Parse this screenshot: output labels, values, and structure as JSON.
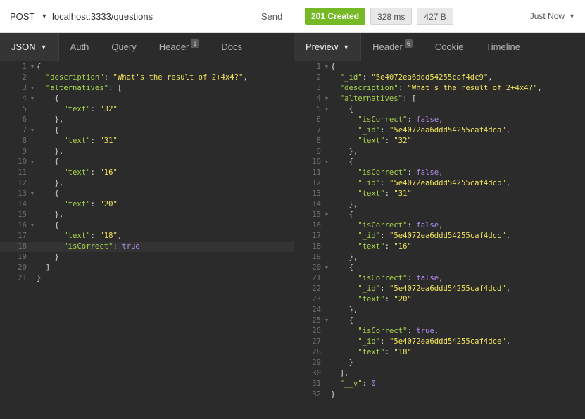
{
  "request": {
    "method": "POST",
    "url": "localhost:3333/questions",
    "send_label": "Send"
  },
  "response": {
    "status": "201 Created",
    "time": "328 ms",
    "size": "427 B",
    "when": "Just Now"
  },
  "request_tabs": [
    {
      "label": "JSON",
      "active": true
    },
    {
      "label": "Auth"
    },
    {
      "label": "Query"
    },
    {
      "label": "Header",
      "count": "1"
    },
    {
      "label": "Docs"
    }
  ],
  "response_tabs": [
    {
      "label": "Preview",
      "active": true
    },
    {
      "label": "Header",
      "count": "6"
    },
    {
      "label": "Cookie"
    },
    {
      "label": "Timeline"
    }
  ],
  "request_body": [
    {
      "n": "1",
      "fold": true,
      "t": [
        [
          "p",
          "{"
        ]
      ]
    },
    {
      "n": "2",
      "t": [
        [
          "p",
          "  "
        ],
        [
          "k",
          "\"description\""
        ],
        [
          "p",
          ": "
        ],
        [
          "s",
          "\"What's the result of 2+4x4?\""
        ],
        [
          "p",
          ","
        ]
      ]
    },
    {
      "n": "3",
      "fold": true,
      "t": [
        [
          "p",
          "  "
        ],
        [
          "k",
          "\"alternatives\""
        ],
        [
          "p",
          ": ["
        ]
      ]
    },
    {
      "n": "4",
      "fold": true,
      "t": [
        [
          "p",
          "    {"
        ]
      ]
    },
    {
      "n": "5",
      "t": [
        [
          "p",
          "      "
        ],
        [
          "k",
          "\"text\""
        ],
        [
          "p",
          ": "
        ],
        [
          "s",
          "\"32\""
        ]
      ]
    },
    {
      "n": "6",
      "t": [
        [
          "p",
          "    },"
        ]
      ]
    },
    {
      "n": "7",
      "fold": true,
      "t": [
        [
          "p",
          "    {"
        ]
      ]
    },
    {
      "n": "8",
      "t": [
        [
          "p",
          "      "
        ],
        [
          "k",
          "\"text\""
        ],
        [
          "p",
          ": "
        ],
        [
          "s",
          "\"31\""
        ]
      ]
    },
    {
      "n": "9",
      "t": [
        [
          "p",
          "    },"
        ]
      ]
    },
    {
      "n": "10",
      "fold": true,
      "t": [
        [
          "p",
          "    {"
        ]
      ]
    },
    {
      "n": "11",
      "t": [
        [
          "p",
          "      "
        ],
        [
          "k",
          "\"text\""
        ],
        [
          "p",
          ": "
        ],
        [
          "s",
          "\"16\""
        ]
      ]
    },
    {
      "n": "12",
      "t": [
        [
          "p",
          "    },"
        ]
      ]
    },
    {
      "n": "13",
      "fold": true,
      "t": [
        [
          "p",
          "    {"
        ]
      ]
    },
    {
      "n": "14",
      "t": [
        [
          "p",
          "      "
        ],
        [
          "k",
          "\"text\""
        ],
        [
          "p",
          ": "
        ],
        [
          "s",
          "\"20\""
        ]
      ]
    },
    {
      "n": "15",
      "t": [
        [
          "p",
          "    },"
        ]
      ]
    },
    {
      "n": "16",
      "fold": true,
      "t": [
        [
          "p",
          "    {"
        ]
      ]
    },
    {
      "n": "17",
      "t": [
        [
          "p",
          "      "
        ],
        [
          "k",
          "\"text\""
        ],
        [
          "p",
          ": "
        ],
        [
          "s",
          "\"18\""
        ],
        [
          "p",
          ","
        ]
      ]
    },
    {
      "n": "18",
      "hl": true,
      "t": [
        [
          "p",
          "      "
        ],
        [
          "k",
          "\"isCorrect\""
        ],
        [
          "p",
          ": "
        ],
        [
          "b",
          "true"
        ]
      ]
    },
    {
      "n": "19",
      "t": [
        [
          "p",
          "    }"
        ]
      ]
    },
    {
      "n": "20",
      "t": [
        [
          "p",
          "  ]"
        ]
      ]
    },
    {
      "n": "21",
      "t": [
        [
          "p",
          "}"
        ]
      ]
    }
  ],
  "response_body": [
    {
      "n": "1",
      "fold": true,
      "t": [
        [
          "p",
          "{"
        ]
      ]
    },
    {
      "n": "2",
      "t": [
        [
          "p",
          "  "
        ],
        [
          "k",
          "\"_id\""
        ],
        [
          "p",
          ": "
        ],
        [
          "s",
          "\"5e4072ea6ddd54255caf4dc9\""
        ],
        [
          "p",
          ","
        ]
      ]
    },
    {
      "n": "3",
      "t": [
        [
          "p",
          "  "
        ],
        [
          "k",
          "\"description\""
        ],
        [
          "p",
          ": "
        ],
        [
          "s",
          "\"What's the result of 2+4x4?\""
        ],
        [
          "p",
          ","
        ]
      ]
    },
    {
      "n": "4",
      "fold": true,
      "t": [
        [
          "p",
          "  "
        ],
        [
          "k",
          "\"alternatives\""
        ],
        [
          "p",
          ": ["
        ]
      ]
    },
    {
      "n": "5",
      "fold": true,
      "t": [
        [
          "p",
          "    {"
        ]
      ]
    },
    {
      "n": "6",
      "t": [
        [
          "p",
          "      "
        ],
        [
          "k",
          "\"isCorrect\""
        ],
        [
          "p",
          ": "
        ],
        [
          "b",
          "false"
        ],
        [
          "p",
          ","
        ]
      ]
    },
    {
      "n": "7",
      "t": [
        [
          "p",
          "      "
        ],
        [
          "k",
          "\"_id\""
        ],
        [
          "p",
          ": "
        ],
        [
          "s",
          "\"5e4072ea6ddd54255caf4dca\""
        ],
        [
          "p",
          ","
        ]
      ]
    },
    {
      "n": "8",
      "t": [
        [
          "p",
          "      "
        ],
        [
          "k",
          "\"text\""
        ],
        [
          "p",
          ": "
        ],
        [
          "s",
          "\"32\""
        ]
      ]
    },
    {
      "n": "9",
      "t": [
        [
          "p",
          "    },"
        ]
      ]
    },
    {
      "n": "10",
      "fold": true,
      "t": [
        [
          "p",
          "    {"
        ]
      ]
    },
    {
      "n": "11",
      "t": [
        [
          "p",
          "      "
        ],
        [
          "k",
          "\"isCorrect\""
        ],
        [
          "p",
          ": "
        ],
        [
          "b",
          "false"
        ],
        [
          "p",
          ","
        ]
      ]
    },
    {
      "n": "12",
      "t": [
        [
          "p",
          "      "
        ],
        [
          "k",
          "\"_id\""
        ],
        [
          "p",
          ": "
        ],
        [
          "s",
          "\"5e4072ea6ddd54255caf4dcb\""
        ],
        [
          "p",
          ","
        ]
      ]
    },
    {
      "n": "13",
      "t": [
        [
          "p",
          "      "
        ],
        [
          "k",
          "\"text\""
        ],
        [
          "p",
          ": "
        ],
        [
          "s",
          "\"31\""
        ]
      ]
    },
    {
      "n": "14",
      "t": [
        [
          "p",
          "    },"
        ]
      ]
    },
    {
      "n": "15",
      "fold": true,
      "t": [
        [
          "p",
          "    {"
        ]
      ]
    },
    {
      "n": "16",
      "t": [
        [
          "p",
          "      "
        ],
        [
          "k",
          "\"isCorrect\""
        ],
        [
          "p",
          ": "
        ],
        [
          "b",
          "false"
        ],
        [
          "p",
          ","
        ]
      ]
    },
    {
      "n": "17",
      "t": [
        [
          "p",
          "      "
        ],
        [
          "k",
          "\"_id\""
        ],
        [
          "p",
          ": "
        ],
        [
          "s",
          "\"5e4072ea6ddd54255caf4dcc\""
        ],
        [
          "p",
          ","
        ]
      ]
    },
    {
      "n": "18",
      "t": [
        [
          "p",
          "      "
        ],
        [
          "k",
          "\"text\""
        ],
        [
          "p",
          ": "
        ],
        [
          "s",
          "\"16\""
        ]
      ]
    },
    {
      "n": "19",
      "t": [
        [
          "p",
          "    },"
        ]
      ]
    },
    {
      "n": "20",
      "fold": true,
      "t": [
        [
          "p",
          "    {"
        ]
      ]
    },
    {
      "n": "21",
      "t": [
        [
          "p",
          "      "
        ],
        [
          "k",
          "\"isCorrect\""
        ],
        [
          "p",
          ": "
        ],
        [
          "b",
          "false"
        ],
        [
          "p",
          ","
        ]
      ]
    },
    {
      "n": "22",
      "t": [
        [
          "p",
          "      "
        ],
        [
          "k",
          "\"_id\""
        ],
        [
          "p",
          ": "
        ],
        [
          "s",
          "\"5e4072ea6ddd54255caf4dcd\""
        ],
        [
          "p",
          ","
        ]
      ]
    },
    {
      "n": "23",
      "t": [
        [
          "p",
          "      "
        ],
        [
          "k",
          "\"text\""
        ],
        [
          "p",
          ": "
        ],
        [
          "s",
          "\"20\""
        ]
      ]
    },
    {
      "n": "24",
      "t": [
        [
          "p",
          "    },"
        ]
      ]
    },
    {
      "n": "25",
      "fold": true,
      "t": [
        [
          "p",
          "    {"
        ]
      ]
    },
    {
      "n": "26",
      "t": [
        [
          "p",
          "      "
        ],
        [
          "k",
          "\"isCorrect\""
        ],
        [
          "p",
          ": "
        ],
        [
          "b",
          "true"
        ],
        [
          "p",
          ","
        ]
      ]
    },
    {
      "n": "27",
      "t": [
        [
          "p",
          "      "
        ],
        [
          "k",
          "\"_id\""
        ],
        [
          "p",
          ": "
        ],
        [
          "s",
          "\"5e4072ea6ddd54255caf4dce\""
        ],
        [
          "p",
          ","
        ]
      ]
    },
    {
      "n": "28",
      "t": [
        [
          "p",
          "      "
        ],
        [
          "k",
          "\"text\""
        ],
        [
          "p",
          ": "
        ],
        [
          "s",
          "\"18\""
        ]
      ]
    },
    {
      "n": "29",
      "t": [
        [
          "p",
          "    }"
        ]
      ]
    },
    {
      "n": "30",
      "t": [
        [
          "p",
          "  ],"
        ]
      ]
    },
    {
      "n": "31",
      "t": [
        [
          "p",
          "  "
        ],
        [
          "k",
          "\"__v\""
        ],
        [
          "p",
          ": "
        ],
        [
          "b",
          "0"
        ]
      ]
    },
    {
      "n": "32",
      "t": [
        [
          "p",
          "}"
        ]
      ]
    }
  ],
  "colors": {
    "status_ok": "#75ba24",
    "key": "#a6d34a",
    "string": "#efe25a",
    "literal": "#b38df0",
    "editor_bg": "#2b2b2b"
  }
}
